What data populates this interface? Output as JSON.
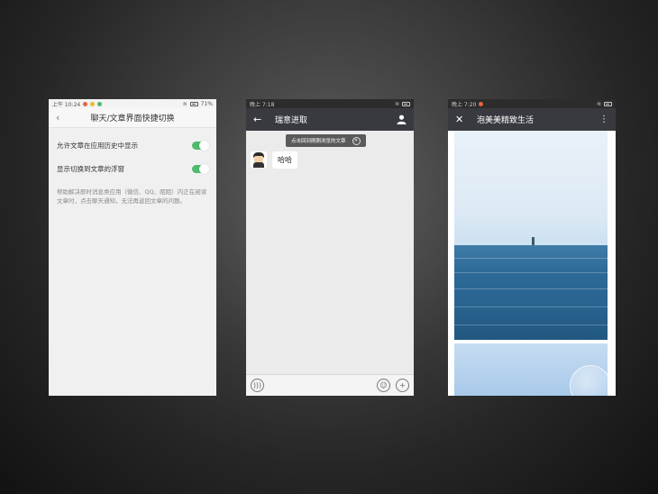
{
  "phone1": {
    "status": {
      "time": "上午 10:24",
      "battery": "71%"
    },
    "header": {
      "back_icon": "chevron-left-icon",
      "title": "聊天/文章界面快捷切换"
    },
    "settings": [
      {
        "label": "允许文章在应用历史中显示",
        "enabled": true
      },
      {
        "label": "显示切换到文章的浮窗",
        "enabled": true
      }
    ],
    "description": "帮助解决即时消息类应用（微信、QQ、陌陌）内正在阅读文章时，点击聊天通知，无法再返回文章的问题。",
    "toggle_color": "#4cbb6c"
  },
  "phone2": {
    "status": {
      "time": "晚上 7:18"
    },
    "header": {
      "title": "瑞意进取"
    },
    "toast": {
      "text": "点击回到刚刚浏览的文章",
      "close": "×"
    },
    "messages": [
      {
        "from": "other",
        "text": "哈哈"
      }
    ],
    "input_bar": {
      "voice_icon": "voice-icon",
      "emoji_icon": "emoji-icon",
      "add_icon": "plus-icon"
    }
  },
  "phone3": {
    "status": {
      "time": "晚上 7:20"
    },
    "header": {
      "title": "泡美美精致生活",
      "close_icon": "close-icon",
      "more_icon": "more-vertical-icon"
    }
  },
  "colors": {
    "dark_header": "#393a3f",
    "accent_green": "#4cbb6c"
  }
}
